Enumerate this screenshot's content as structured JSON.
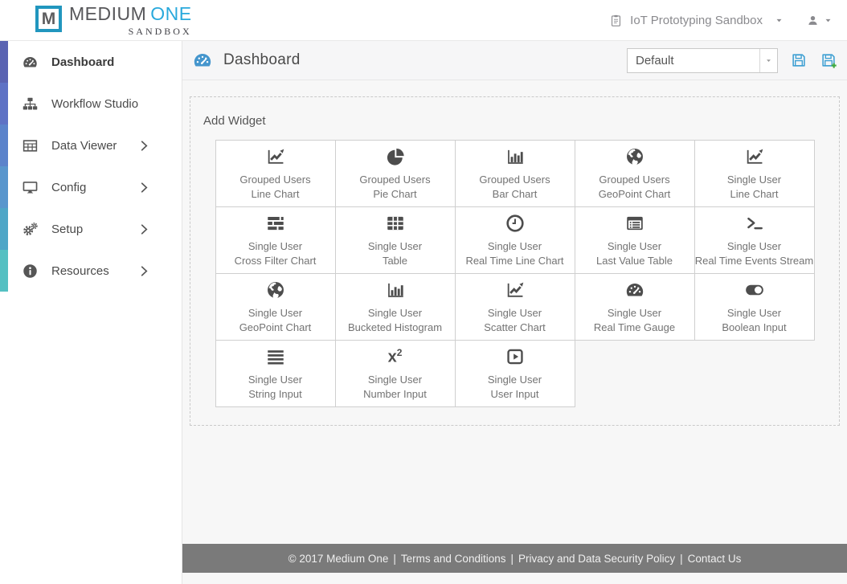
{
  "topbar": {
    "logo": {
      "mark": "M",
      "brand_medium": "MEDIUM",
      "brand_one": "ONE",
      "brand_sub": "SANDBOX"
    },
    "sandbox_selector": {
      "icon": "clipboard-icon",
      "label": "IoT Prototyping Sandbox"
    },
    "user_menu": {
      "icon": "user-icon"
    }
  },
  "sidebar": {
    "items": [
      {
        "id": "dashboard",
        "icon": "tachometer-icon",
        "label": "Dashboard",
        "active": true,
        "chevron": false,
        "strip_color": "#5a63b2"
      },
      {
        "id": "workflow-studio",
        "icon": "sitemap-icon",
        "label": "Workflow Studio",
        "active": false,
        "chevron": false,
        "strip_color": "#5e72c5"
      },
      {
        "id": "data-viewer",
        "icon": "table-icon",
        "label": "Data Viewer",
        "active": false,
        "chevron": true,
        "strip_color": "#5b83cb"
      },
      {
        "id": "config",
        "icon": "desktop-icon",
        "label": "Config",
        "active": false,
        "chevron": true,
        "strip_color": "#5996cd"
      },
      {
        "id": "setup",
        "icon": "gears-icon",
        "label": "Setup",
        "active": false,
        "chevron": true,
        "strip_color": "#4fa6c7"
      },
      {
        "id": "resources",
        "icon": "info-circle-icon",
        "label": "Resources",
        "active": false,
        "chevron": true,
        "strip_color": "#54c0c2"
      }
    ]
  },
  "page_header": {
    "icon": "tachometer-icon",
    "title": "Dashboard",
    "dashboard_select": {
      "value": "Default"
    },
    "save_icon": "save-icon",
    "save_as_icon": "save-plus-icon"
  },
  "widget_panel": {
    "title": "Add Widget",
    "columns": 5,
    "widgets": [
      {
        "icon": "line-chart-icon",
        "line1": "Grouped Users",
        "line2": "Line Chart"
      },
      {
        "icon": "pie-chart-icon",
        "line1": "Grouped Users",
        "line2": "Pie Chart"
      },
      {
        "icon": "bar-chart-icon",
        "line1": "Grouped Users",
        "line2": "Bar Chart"
      },
      {
        "icon": "globe-icon",
        "line1": "Grouped Users",
        "line2": "GeoPoint Chart"
      },
      {
        "icon": "line-chart-icon",
        "line1": "Single User",
        "line2": "Line Chart"
      },
      {
        "icon": "cross-filter-icon",
        "line1": "Single User",
        "line2": "Cross Filter Chart"
      },
      {
        "icon": "table-grid-icon",
        "line1": "Single User",
        "line2": "Table"
      },
      {
        "icon": "clock-icon",
        "line1": "Single User",
        "line2": "Real Time Line Chart"
      },
      {
        "icon": "list-alt-icon",
        "line1": "Single User",
        "line2": "Last Value Table"
      },
      {
        "icon": "terminal-icon",
        "line1": "Single User",
        "line2": "Real Time Events Stream"
      },
      {
        "icon": "globe-icon",
        "line1": "Single User",
        "line2": "GeoPoint Chart"
      },
      {
        "icon": "histogram-icon",
        "line1": "Single User",
        "line2": "Bucketed Histogram"
      },
      {
        "icon": "scatter-chart-icon",
        "line1": "Single User",
        "line2": "Scatter Chart"
      },
      {
        "icon": "gauge-icon",
        "line1": "Single User",
        "line2": "Real Time Gauge"
      },
      {
        "icon": "toggle-icon",
        "line1": "Single User",
        "line2": "Boolean Input"
      },
      {
        "icon": "string-input-icon",
        "line1": "Single User",
        "line2": "String Input"
      },
      {
        "icon": "number-input-icon",
        "line1": "Single User",
        "line2": "Number Input"
      },
      {
        "icon": "user-input-icon",
        "line1": "Single User",
        "line2": "User Input"
      }
    ]
  },
  "footer": {
    "copyright": "© 2017 Medium One",
    "separator": "|",
    "links": [
      "Terms and Conditions",
      "Privacy and Data Security Policy",
      "Contact Us"
    ]
  },
  "colors": {
    "logo_teal": "#2196be",
    "logo_one_blue": "#29a9dc",
    "header_icon_blue": "#4596cd",
    "save_blue": "#3b9ed2",
    "save_plus_green": "#3faa3f",
    "footer_bg": "#7a7a7a"
  }
}
